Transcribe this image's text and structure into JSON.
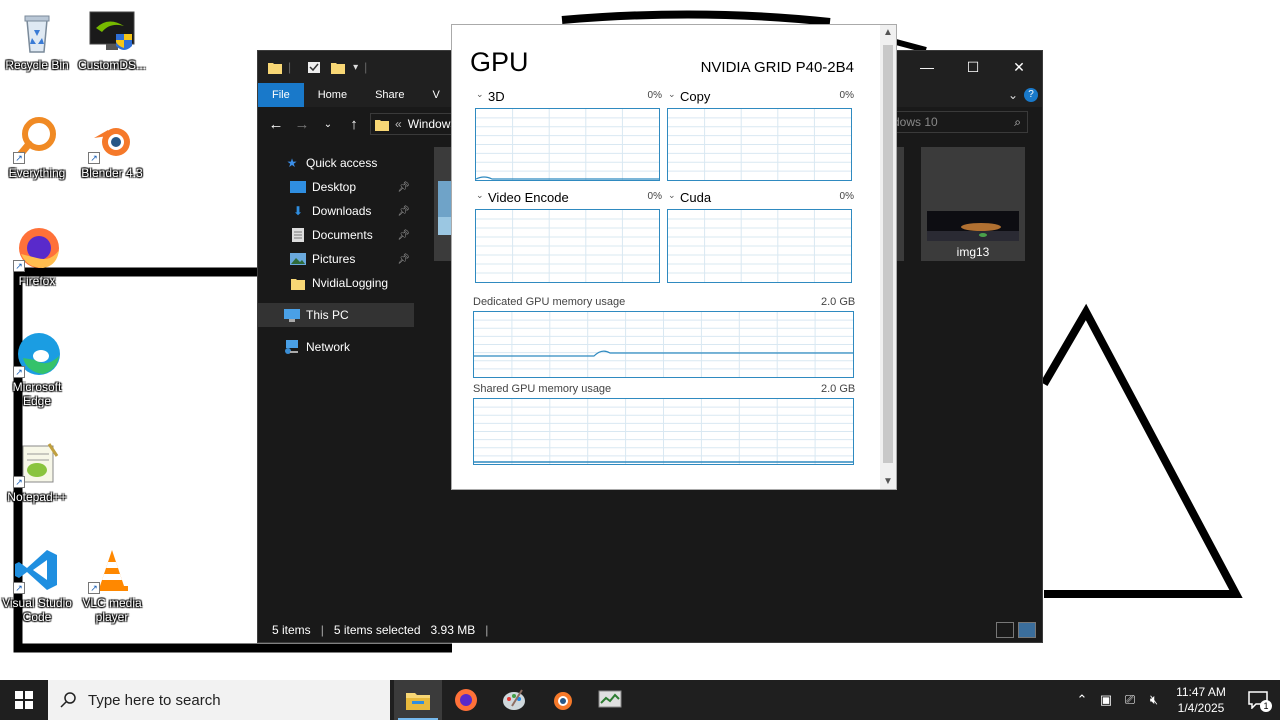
{
  "desktop": {
    "icons": [
      {
        "label": "Recycle Bin"
      },
      {
        "label": "CustomDS..."
      },
      {
        "label": "Everything"
      },
      {
        "label": "Blender 4.3"
      },
      {
        "label": "Firefox"
      },
      {
        "label": "Microsoft Edge"
      },
      {
        "label": "Notepad++"
      },
      {
        "label": "Visual Studio Code"
      },
      {
        "label": "VLC media player"
      }
    ]
  },
  "explorer": {
    "ribbon_tabs": [
      "File",
      "Home",
      "Share",
      "V"
    ],
    "address_text": "Windows",
    "address_prefix": "«",
    "search_placeholder": "dows 10",
    "nav": {
      "quick_access": "Quick access",
      "items": [
        "Desktop",
        "Downloads",
        "Documents",
        "Pictures",
        "NvidiaLogging"
      ],
      "this_pc": "This PC",
      "network": "Network"
    },
    "thumbnail_label": "img13",
    "status": {
      "items": "5 items",
      "separator": "|",
      "selected": "5 items selected",
      "size": "3.93 MB"
    }
  },
  "gpu": {
    "title": "GPU",
    "model": "NVIDIA GRID P40-2B4",
    "engines": [
      {
        "label": "3D",
        "percent": "0%"
      },
      {
        "label": "Copy",
        "percent": "0%"
      },
      {
        "label": "Video Encode",
        "percent": "0%"
      },
      {
        "label": "Cuda",
        "percent": "0%"
      }
    ],
    "dedicated_label": "Dedicated GPU memory usage",
    "dedicated_max": "2.0 GB",
    "shared_label": "Shared GPU memory usage",
    "shared_max": "2.0 GB"
  },
  "taskbar": {
    "search_placeholder": "Type here to search",
    "time": "11:47 AM",
    "date": "1/4/2025",
    "notification_count": "1"
  },
  "colors": {
    "accent": "#1979ca",
    "graph_line": "#2f8ac0",
    "explorer_bg": "#191919",
    "taskbar_bg": "#1f1f1f"
  }
}
